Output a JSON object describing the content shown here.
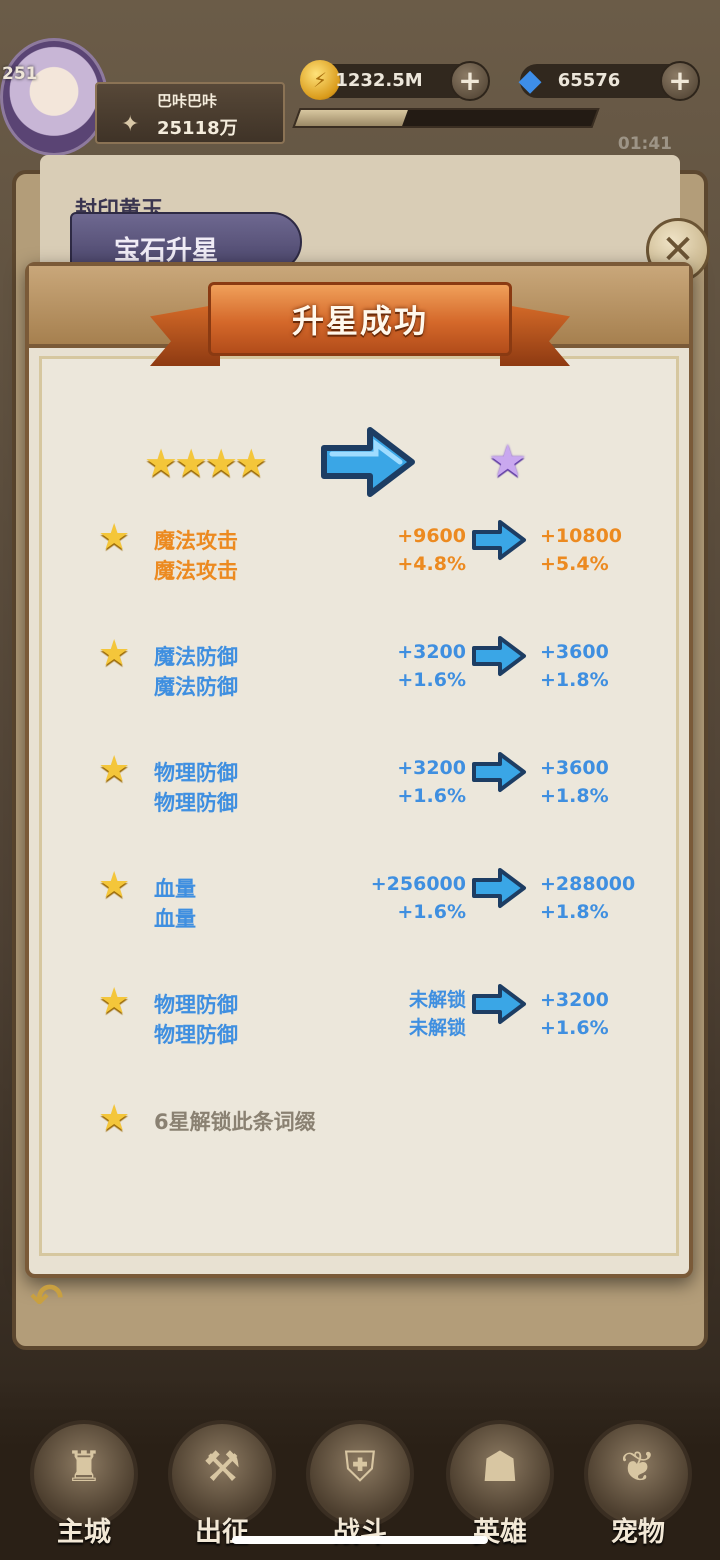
{
  "player": {
    "level": "251",
    "name": "巴咔巴咔",
    "power": "25118万"
  },
  "resources": {
    "gold": "1232.5M",
    "gems": "65576",
    "exp_progress": 0.36
  },
  "clock": "01:41",
  "background": {
    "title": "封印黄玉",
    "tab_label": "宝石升星"
  },
  "modal": {
    "title": "升星成功",
    "stars_before": 4,
    "stats": [
      {
        "name1": "魔法攻击",
        "name2": "魔法攻击",
        "old1": "+9600",
        "old2": "+4.8%",
        "new1": "+10800",
        "new2": "+5.4%",
        "color": "#ec8a20"
      },
      {
        "name1": "魔法防御",
        "name2": "魔法防御",
        "old1": "+3200",
        "old2": "+1.6%",
        "new1": "+3600",
        "new2": "+1.8%",
        "color": "#3f8fe0"
      },
      {
        "name1": "物理防御",
        "name2": "物理防御",
        "old1": "+3200",
        "old2": "+1.6%",
        "new1": "+3600",
        "new2": "+1.8%",
        "color": "#3f8fe0"
      },
      {
        "name1": "血量",
        "name2": "血量",
        "old1": "+256000",
        "old2": "+1.6%",
        "new1": "+288000",
        "new2": "+1.8%",
        "color": "#3f8fe0"
      },
      {
        "name1": "物理防御",
        "name2": "物理防御",
        "old1": "未解锁",
        "old2": "未解锁",
        "new1": "+3200",
        "new2": "+1.6%",
        "color": "#3f8fe0"
      }
    ],
    "unlock_note": "6星解锁此条词缀"
  },
  "nav": [
    {
      "label": "主城",
      "icon": "castle-icon"
    },
    {
      "label": "出征",
      "icon": "crossed-axes-icon"
    },
    {
      "label": "战斗",
      "icon": "shield-icon"
    },
    {
      "label": "英雄",
      "icon": "hooded-hero-icon"
    },
    {
      "label": "宠物",
      "icon": "dragon-icon"
    }
  ]
}
